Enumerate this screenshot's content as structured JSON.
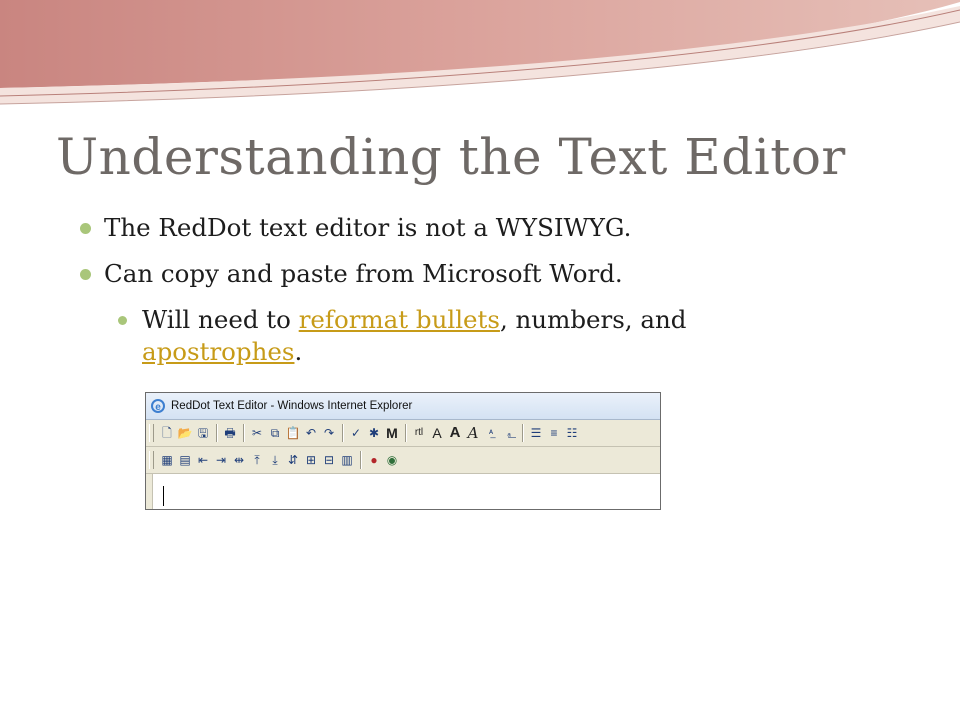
{
  "slide": {
    "title": "Understanding the Text Editor",
    "bullets": [
      "The RedDot text editor is not a WYSIWYG.",
      "Can copy and paste from Microsoft Word."
    ],
    "sub_bullet": {
      "prefix": "Will need to ",
      "link1": "reformat bullets",
      "middle": ", numbers, and ",
      "link2": "apostrophes",
      "suffix": "."
    }
  },
  "screenshot": {
    "window_title": "RedDot Text Editor - Windows Internet Explorer",
    "toolbar1": {
      "bold_m": "M",
      "rtl": "rtl",
      "font_small": "A",
      "font_bold": "A",
      "font_italic": "A"
    }
  },
  "colors": {
    "title": "#6e6966",
    "bullet": "#a9c67a",
    "link": "#c79b18",
    "swoosh": "#d98f8a"
  }
}
